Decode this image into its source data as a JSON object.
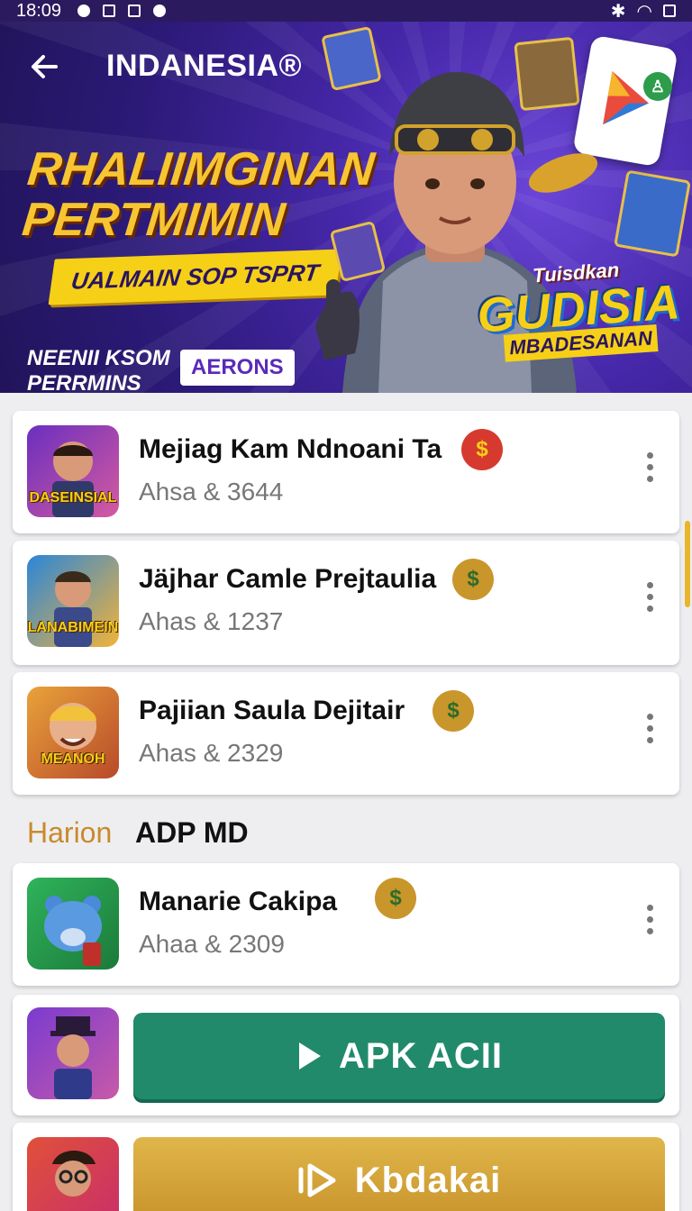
{
  "status_bar": {
    "time": "18:09"
  },
  "header": {
    "title": "INDANESIA®"
  },
  "banner": {
    "headline_line1": "RHALIIMGINAN",
    "headline_line2": "PERTMIMIN",
    "strip_text": "UALMAIN SOP TSPRT",
    "sub_line1": "NEENII KSOM",
    "sub_line2": "PERRMINS",
    "pill_text": "AERONS",
    "logo_small": "Tuisdkan",
    "logo_big": "GUDISIA",
    "logo_bottom": "MBADESANAN"
  },
  "list_items": [
    {
      "name": "Mejiag Kam Ndnoani Ta",
      "meta": "Ahsa & 3644",
      "thumb_caption": "DASEINSIAL",
      "coin_color": "#d63a2f"
    },
    {
      "name": "Jäjhar Camle Prejtaulia",
      "meta": "Ahas & 1237",
      "thumb_caption": "LANABIMEIN",
      "coin_color": "#c9962b"
    },
    {
      "name": "Pajiian Saula Dejitair",
      "meta": "Ahas & 2329",
      "thumb_caption": "MEANOH",
      "coin_color": "#c9962b"
    }
  ],
  "section": {
    "label_accent": "Harion",
    "label_main": "ADP MD"
  },
  "featured_item": {
    "name": "Manarie Cakipa",
    "meta": "Ahaa & 2309",
    "coin_color": "#c9962b"
  },
  "buttons": {
    "apk_label": "APK ACII",
    "kbdakai_label": "Kbdakai"
  },
  "colors": {
    "banner_bg": "#2c1a78",
    "headline": "#f7c531",
    "green_button": "#218a6a",
    "gold_button": "#d4a53a"
  }
}
